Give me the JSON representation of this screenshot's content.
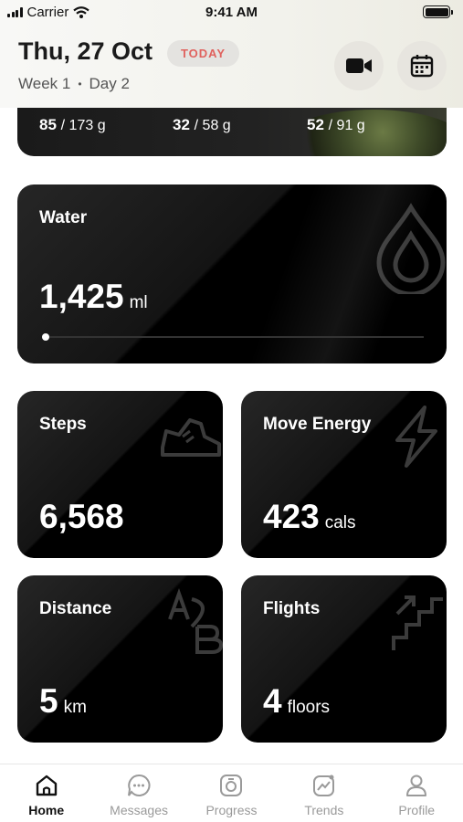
{
  "status_bar": {
    "carrier": "Carrier",
    "time": "9:41 AM"
  },
  "header": {
    "date": "Thu, 27 Oct",
    "badge": "TODAY",
    "week": "Week 1",
    "separator": "•",
    "day": "Day 2",
    "actions": [
      {
        "icon": "video-camera-icon"
      },
      {
        "icon": "calendar-icon"
      }
    ]
  },
  "macros": [
    {
      "value": "85",
      "goal": "/ 173 g"
    },
    {
      "value": "32",
      "goal": "/ 58 g"
    },
    {
      "value": "52",
      "goal": "/ 91 g"
    }
  ],
  "water": {
    "label": "Water",
    "value": "1,425",
    "unit": "ml",
    "progress": 0.0,
    "icon": "water-drop-icon"
  },
  "cards": {
    "steps": {
      "label": "Steps",
      "value": "6,568",
      "unit": "",
      "icon": "sneaker-icon"
    },
    "move_energy": {
      "label": "Move Energy",
      "value": "423",
      "unit": "cals",
      "icon": "lightning-icon"
    },
    "distance": {
      "label": "Distance",
      "value": "5",
      "unit": "km",
      "icon": "a-to-b-icon"
    },
    "flights": {
      "label": "Flights",
      "value": "4",
      "unit": "floors",
      "icon": "stairs-icon"
    }
  },
  "tabs": [
    {
      "label": "Home",
      "icon": "home-icon",
      "active": true
    },
    {
      "label": "Messages",
      "icon": "messages-icon",
      "active": false
    },
    {
      "label": "Progress",
      "icon": "progress-icon",
      "active": false
    },
    {
      "label": "Trends",
      "icon": "trends-icon",
      "active": false
    },
    {
      "label": "Profile",
      "icon": "profile-icon",
      "active": false
    }
  ],
  "colors": {
    "accent": "#e0625e",
    "card": "#000000",
    "muted": "#9a9a9a"
  }
}
